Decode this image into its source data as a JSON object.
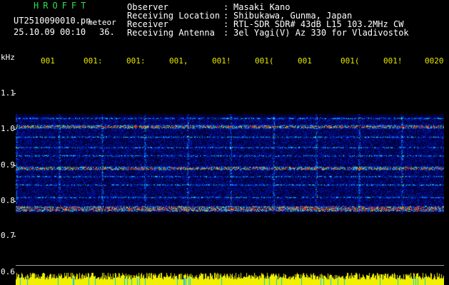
{
  "header": {
    "app_title": "HROFFT",
    "filename": "UT2510090010.pn",
    "filename_suffix": "meteor",
    "datetime": "25.10.09 00:10",
    "count": "36."
  },
  "info": [
    {
      "label": "Observer",
      "colon": ":",
      "value": "Masaki Kano"
    },
    {
      "label": "Receiving Location",
      "colon": ":",
      "value": "Shibukawa, Gunma, Japan"
    },
    {
      "label": "Receiver",
      "colon": ":",
      "value": "RTL-SDR SDR# 43dB L15 103.2MHz CW"
    },
    {
      "label": "Receiving Antenna",
      "colon": ":",
      "value": "3el Yagi(V) Az 330 for Vladivostok"
    }
  ],
  "axis": {
    "y_unit": "kHz",
    "y_ticks": [
      "1.1",
      "1.0",
      "0.9",
      "0.8",
      "0.7",
      "0.6"
    ],
    "x_ticks": [
      "001",
      "001:",
      "001:",
      "001,",
      "001!",
      "001(",
      "001",
      "001(",
      "001!",
      "0020"
    ]
  },
  "colors": {
    "background": "#000000",
    "header_green": "#2ee04a",
    "info_white": "#ffffff",
    "tick_yellow": "#e8e800",
    "signal_yellow": "#f0f000",
    "signal_cyan": "#00c8ff",
    "waterfall_blue": "#0018a0"
  },
  "waterfall": {
    "freq_range_khz": [
      0.79,
      1.03
    ],
    "strong_bands_khz": [
      0.8,
      0.805,
      0.9,
      1.0
    ],
    "weak_bands_khz": [
      0.83,
      0.86,
      0.88,
      0.93,
      0.95,
      0.975,
      1.02
    ]
  }
}
